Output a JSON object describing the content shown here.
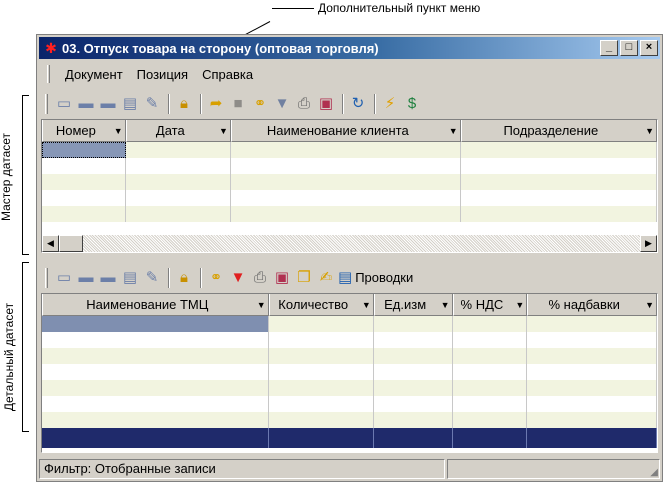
{
  "annotations": {
    "menu_item_note": "Дополнительный пункт меню",
    "master_label": "Мастер датасет",
    "detail_label": "Детальный датасет"
  },
  "window": {
    "title": "03. Отпуск товара на сторону (оптовая торговля)",
    "minimize": "_",
    "maximize": "□",
    "close": "×"
  },
  "menu": [
    "Документ",
    "Позиция",
    "Справка"
  ],
  "master_toolbar": {
    "icons": [
      "folder-icon",
      "folder-add-icon",
      "folder-edit-icon",
      "folder-copy-icon",
      "folder-check-icon",
      "lock-icon",
      "open-icon",
      "stop-icon",
      "find-icon",
      "filter-icon",
      "print-icon",
      "report-icon",
      "refresh-icon",
      "lightning-icon",
      "money-icon"
    ]
  },
  "master_grid": {
    "columns": [
      "Номер",
      "Дата",
      "Наименование клиента",
      "Подразделение"
    ],
    "rows": 5
  },
  "detail_toolbar": {
    "postings_label": "Проводки"
  },
  "detail_grid": {
    "columns": [
      "Наименование ТМЦ",
      "Количество",
      "Ед.изм",
      "% НДС",
      "% надбавки"
    ],
    "rows": 7
  },
  "status": {
    "filter_text": "Фильтр: Отобранные записи",
    "second_pane": ""
  },
  "colors": {
    "window_bg": "#d4d0c8",
    "title_start": "#0a246a",
    "title_end": "#a6caf0",
    "row_alt": "#f2f4e0",
    "selection": "#7f8fb0",
    "totals_row": "#1f2a6b"
  }
}
